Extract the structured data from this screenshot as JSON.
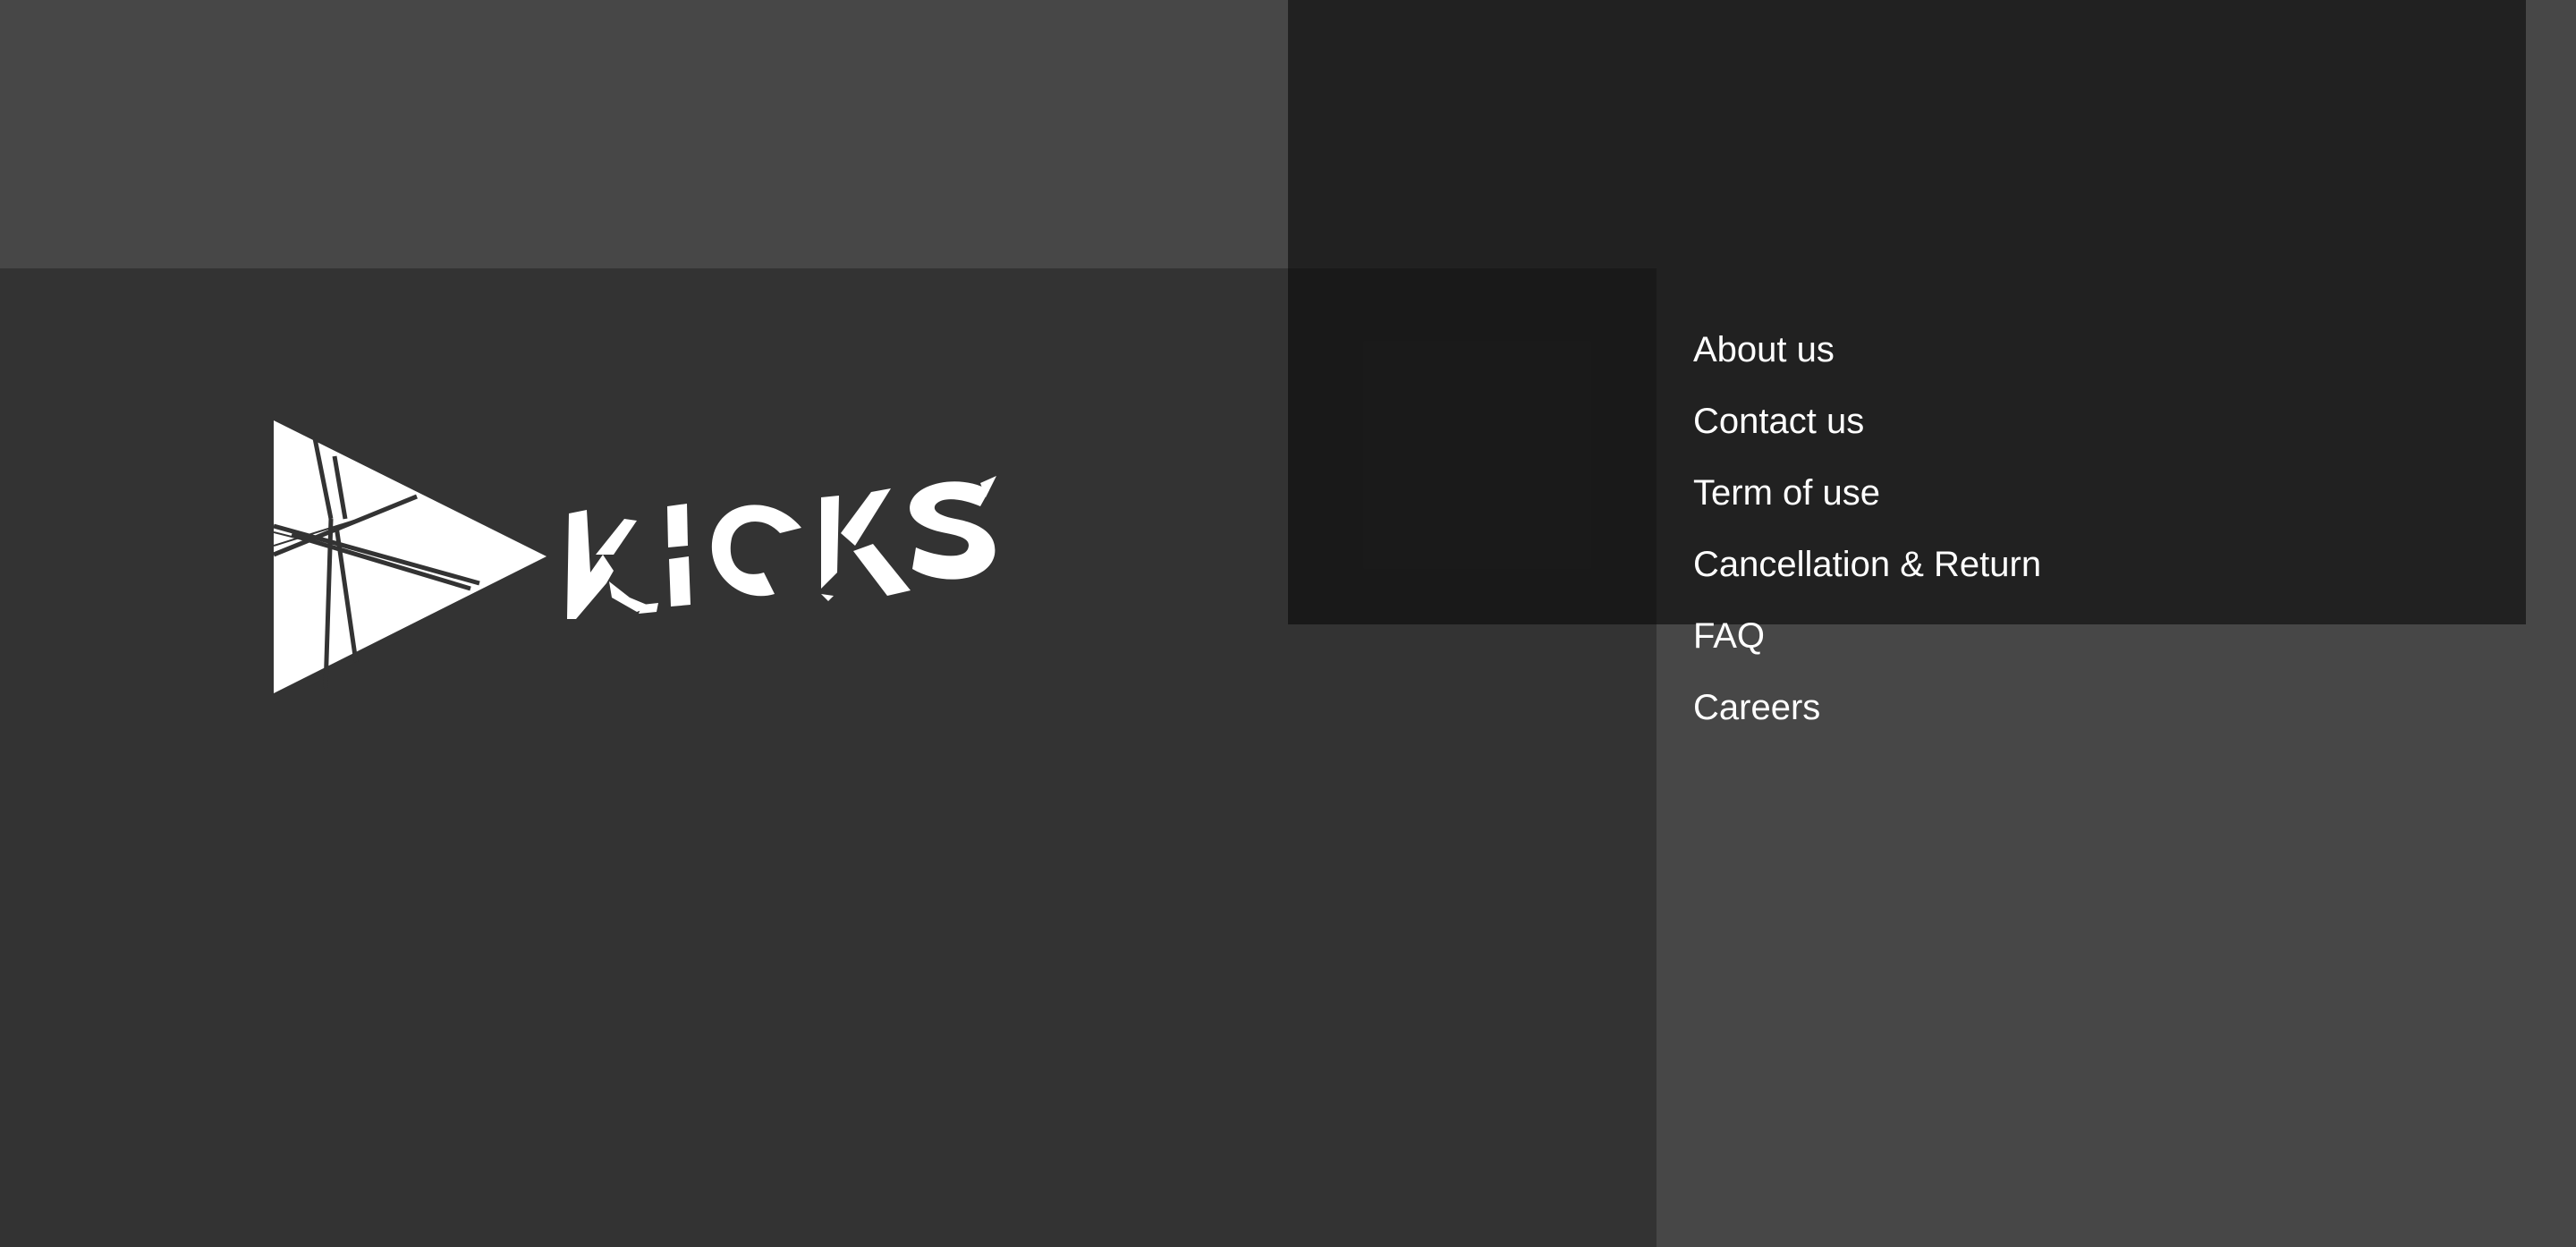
{
  "brand": {
    "logo_text": "KICKS",
    "logo_icon": "play-triangle-icon",
    "logo_color": "#ffffff"
  },
  "colors": {
    "page_background": "#474747",
    "footer_background": "#333333",
    "overlay_panel": "#1c1c1c",
    "link_text": "#ffffff"
  },
  "footer_nav": {
    "items": [
      {
        "label": "About us"
      },
      {
        "label": "Contact us"
      },
      {
        "label": "Term of use"
      },
      {
        "label": "Cancellation & Return"
      },
      {
        "label": "FAQ"
      },
      {
        "label": "Careers"
      }
    ]
  }
}
